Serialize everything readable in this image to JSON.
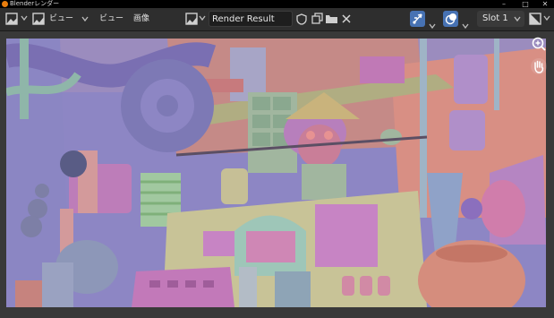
{
  "window": {
    "title": "Blenderレンダー",
    "controls": [
      "minimize",
      "maximize",
      "close"
    ]
  },
  "header": {
    "editor_type_icon": "image-editor-icon",
    "image_icon": "image-icon",
    "menus": [
      {
        "label": "ビュー"
      },
      {
        "label": "ビュー"
      },
      {
        "label": "画像"
      }
    ],
    "browse_icon": "image-browse-icon",
    "image_name": "Render Result",
    "fake_user_icon": "shield-icon",
    "duplicate_icon": "duplicate-icon",
    "open_icon": "folder-icon",
    "unlink_icon": "close-icon",
    "gizmo_icon": "gizmo-icon",
    "overlay_icon": "overlay-icon",
    "slot_label": "Slot 1",
    "display_channels_icon": "display-channels-icon"
  },
  "viewport": {
    "zoom_icon": "zoom-icon",
    "pan_icon": "hand-icon",
    "render_description": "clay render of a workshop scene"
  },
  "colors": {
    "accent_blue": "#4772b3",
    "header_bg": "#2e2e2e",
    "viewport_bg": "#393939"
  }
}
